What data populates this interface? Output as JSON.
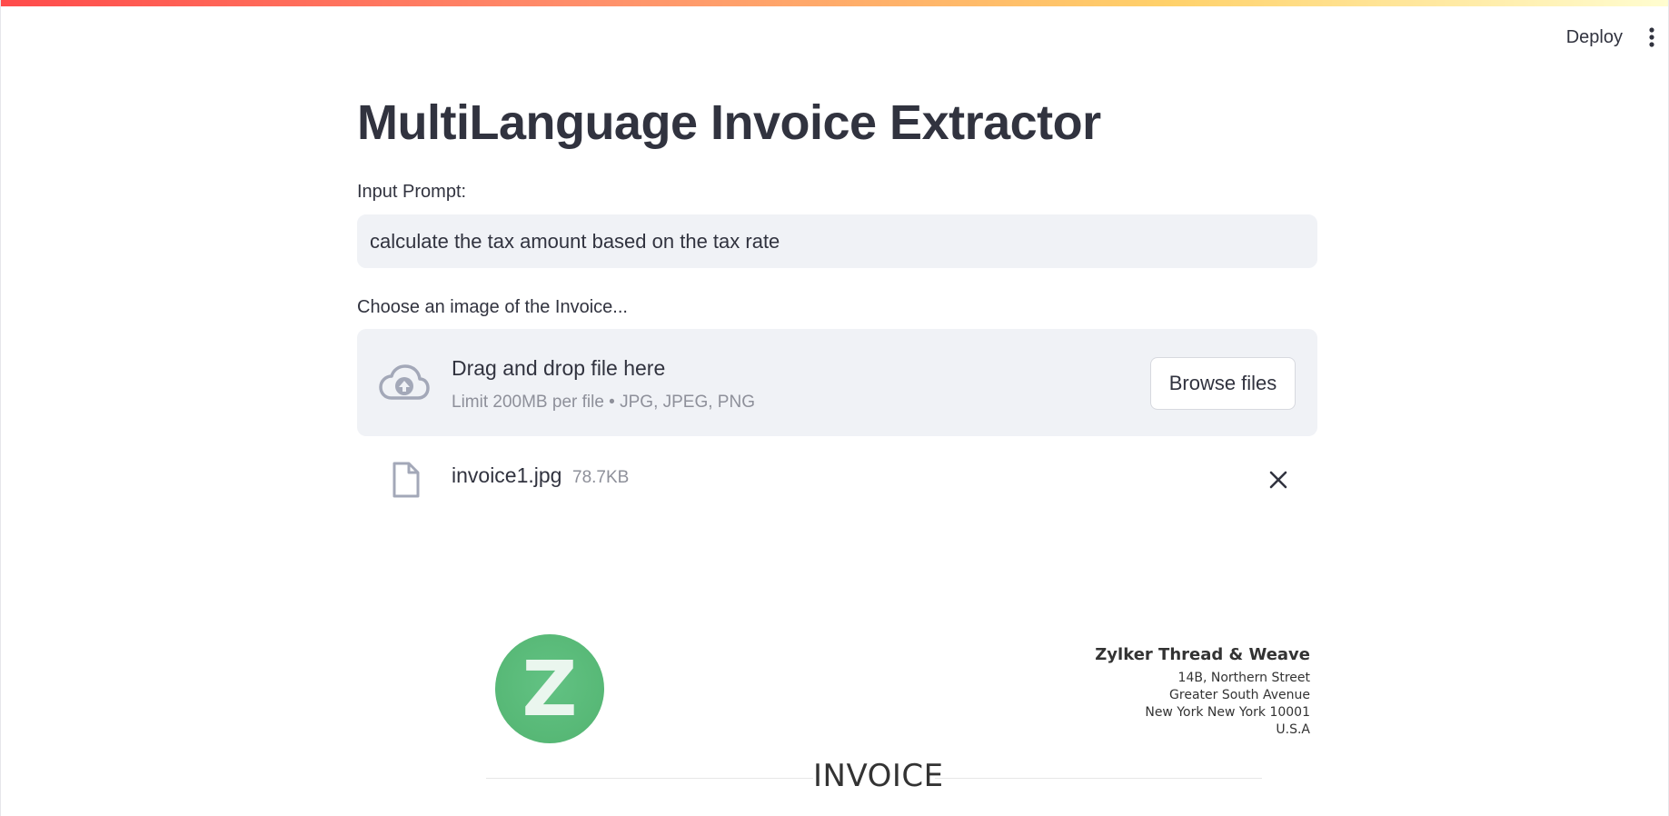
{
  "toolbar": {
    "deploy_label": "Deploy",
    "menu_icon": "kebab-menu-icon"
  },
  "main": {
    "title": "MultiLanguage Invoice Extractor",
    "prompt": {
      "label": "Input Prompt:",
      "value": "calculate the tax amount based on the tax rate"
    },
    "uploader": {
      "label": "Choose an image of the Invoice...",
      "icon": "cloud-upload-icon",
      "drop_title": "Drag and drop file here",
      "drop_limit": "Limit 200MB per file • JPG, JPEG, PNG",
      "browse_label": "Browse files"
    },
    "uploaded_file": {
      "icon": "file-icon",
      "name": "invoice1.jpg",
      "size": "78.7KB",
      "remove_icon": "close-icon"
    },
    "invoice_preview": {
      "logo_letter": "Z",
      "company_name": "Zylker Thread & Weave",
      "address_lines": [
        "14B, Northern Street",
        "Greater South Avenue",
        "New York New York 10001",
        "U.S.A"
      ],
      "heading": "INVOICE"
    }
  },
  "colors": {
    "text": "#31333f",
    "muted": "#8e909a",
    "input_bg": "#f0f2f6",
    "icon": "#a3a8b8",
    "logo_green": "#57b876"
  }
}
